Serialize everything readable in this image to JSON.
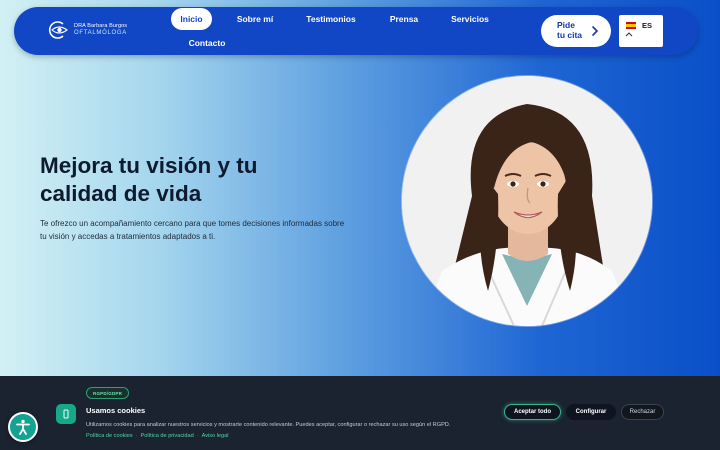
{
  "logo": {
    "line1": "DRA Barbara Burgos",
    "line2": "OFTALMÓLOGA",
    "icon": "eye-logo-icon"
  },
  "nav": {
    "items": [
      {
        "label": "Inicio",
        "active": true
      },
      {
        "label": "Sobre mí",
        "active": false
      },
      {
        "label": "Testimonios",
        "active": false
      },
      {
        "label": "Prensa",
        "active": false
      },
      {
        "label": "Servicios",
        "active": false
      },
      {
        "label": "Contacto",
        "active": false
      }
    ],
    "cta_label": "Pide tu cita",
    "cta_icon": "chevron-right-icon",
    "language": {
      "code": "ES",
      "flag": "spain-flag-icon",
      "caret": "chevron-up-icon"
    }
  },
  "hero": {
    "title": "Mejora tu visión y tu calidad de vida",
    "subtitle": "Te ofrezco un acompañamiento cercano para que tomes decisiones informadas sobre tu visión y accedas a tratamientos adaptados a ti."
  },
  "cookies": {
    "badge": "RGPD/GDPR",
    "title": "Usamos cookies",
    "text": "Utilizamos cookies para analizar nuestros servicios y mostrarte contenido relevante. Puedes aceptar, configurar o rechazar su uso según el RGPD.",
    "links": [
      "Política de cookies",
      "Política de privacidad",
      "Aviso legal"
    ],
    "separator": "·",
    "accept_label": "Aceptar todo",
    "configure_label": "Configurar",
    "reject_label": "Rechazar"
  },
  "accessibility": {
    "icon": "accessibility-icon"
  },
  "colors": {
    "nav_bg": "#1146c4",
    "accent_green": "#17a88a",
    "banner_bg": "#1b2331"
  }
}
